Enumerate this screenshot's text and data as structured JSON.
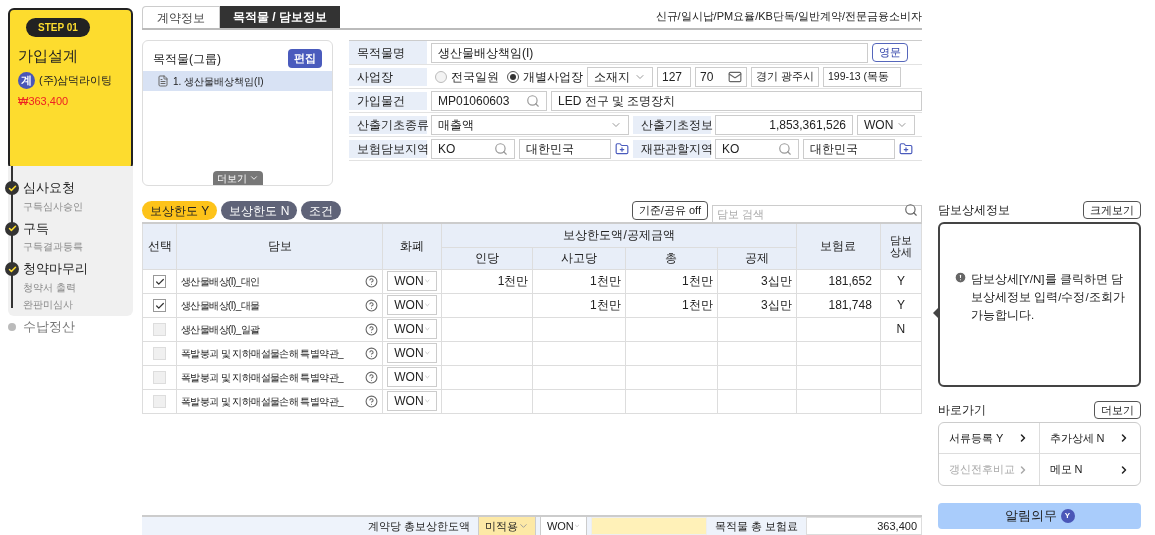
{
  "sidebar": {
    "current_step": {
      "badge": "STEP 01",
      "title": "가입설계",
      "company_icon": "계",
      "company": "(주)삼덕라이팅",
      "amount": "₩363,400"
    },
    "steps": [
      {
        "title": "심사요청",
        "done": true,
        "subs": [
          "구득심사승인"
        ]
      },
      {
        "title": "구득",
        "done": true,
        "subs": [
          "구득결과등륵"
        ]
      },
      {
        "title": "청약마무리",
        "done": true,
        "subs": [
          "청약서 출력",
          "완판미심사"
        ]
      },
      {
        "title": "수납정산",
        "done": false
      }
    ]
  },
  "tabs": [
    {
      "label": "계약정보",
      "selected": false
    },
    {
      "label": "목적물 / 담보정보",
      "selected": true
    }
  ],
  "contract_summary": "신규/일시납/PM요율/KB단독/일반계약/전문금융소비자",
  "group_panel": {
    "title": "목적물(그룹)",
    "edit_button": "편집",
    "items": [
      {
        "label": "1. 생산물배상책임(I)",
        "selected": true
      }
    ],
    "more_button": "더보기"
  },
  "object_form": {
    "name_label": "목적물명",
    "name_value": "생산물배상책임(I)",
    "english_button": "영문",
    "site": {
      "label": "사업장",
      "radios": [
        {
          "label": "전국일원",
          "selected": false
        },
        {
          "label": "개별사업장",
          "selected": true
        }
      ],
      "location_select": "소재지",
      "zip1": "127",
      "zip2": "70",
      "address1": "경기 광주시",
      "address2": "199-13 (목동"
    },
    "property": {
      "label": "가입물건",
      "code": "MP01060603",
      "description": "LED 전구 및 조명장치"
    },
    "basis": {
      "label": "산출기초종류",
      "type": "매출액",
      "info_label": "산출기초정보",
      "info_value": "1,853,361,526",
      "currency": "WON"
    },
    "regions": [
      {
        "label": "보험담보지역",
        "code": "KO",
        "name": "대한민국"
      },
      {
        "label": "재판관할지역",
        "code": "KO",
        "name": "대한민국"
      }
    ]
  },
  "filters": [
    {
      "label": "보상한도 Y",
      "selected": true
    },
    {
      "label": "보상한도 N",
      "selected": false
    },
    {
      "label": "조건",
      "selected": false
    }
  ],
  "share_toggle": "기준/공유 off",
  "search": {
    "placeholder": "담보 검색"
  },
  "table": {
    "columns": [
      "선택",
      "담보",
      "화폐"
    ],
    "group_header": "보상한도액/공제금액",
    "sub_columns": [
      "인당",
      "사고당",
      "총",
      "공제"
    ],
    "after_columns": [
      "보험료",
      "담보상세"
    ],
    "rows": [
      {
        "checked": true,
        "coverage": "생산물배상(I)_대인",
        "currency": "WON",
        "per_person": "1천만",
        "per_accident": "1천만",
        "total": "1천만",
        "deductible": "3십만",
        "premium": "181,652",
        "detail": "Y"
      },
      {
        "checked": true,
        "coverage": "생산물배상(I)_대물",
        "currency": "WON",
        "per_accident": "1천만",
        "total": "1천만",
        "deductible": "3십만",
        "premium": "181,748",
        "detail": "Y"
      },
      {
        "checked": false,
        "coverage": "생산물배상(I)_일괄",
        "currency": "WON",
        "detail": "N"
      },
      {
        "checked": false,
        "coverage": "폭발붕괴 및 지하매설물손해 특별약관_",
        "currency": "WON"
      },
      {
        "checked": false,
        "coverage": "폭발붕괴 및 지하매설물손해 특별약관_",
        "currency": "WON"
      },
      {
        "checked": false,
        "coverage": "폭발붕괴 및 지하매설물손해 특별약관_",
        "currency": "WON"
      }
    ]
  },
  "detail_panel": {
    "title": "담보상세정보",
    "expand_button": "크게보기",
    "message": "담보상세[Y/N]를 클릭하면 담보상세정보 입력/수정/조회가 가능합니다."
  },
  "shortcuts": {
    "title": "바로가기",
    "more_button": "더보기",
    "items": [
      {
        "label": "서류등록 Y",
        "disabled": false
      },
      {
        "label": "추가상세 N",
        "disabled": false
      },
      {
        "label": "갱신전후비교",
        "disabled": true
      },
      {
        "label": "메모 N",
        "disabled": false
      }
    ]
  },
  "notice_button": {
    "label": "알림의무",
    "badge": "Y"
  },
  "footer": {
    "limit_label": "계약당 총보상한도액",
    "limit_select": "미적용",
    "currency": "WON",
    "premium_label": "목적물 총 보험료",
    "premium_value": "363,400"
  }
}
